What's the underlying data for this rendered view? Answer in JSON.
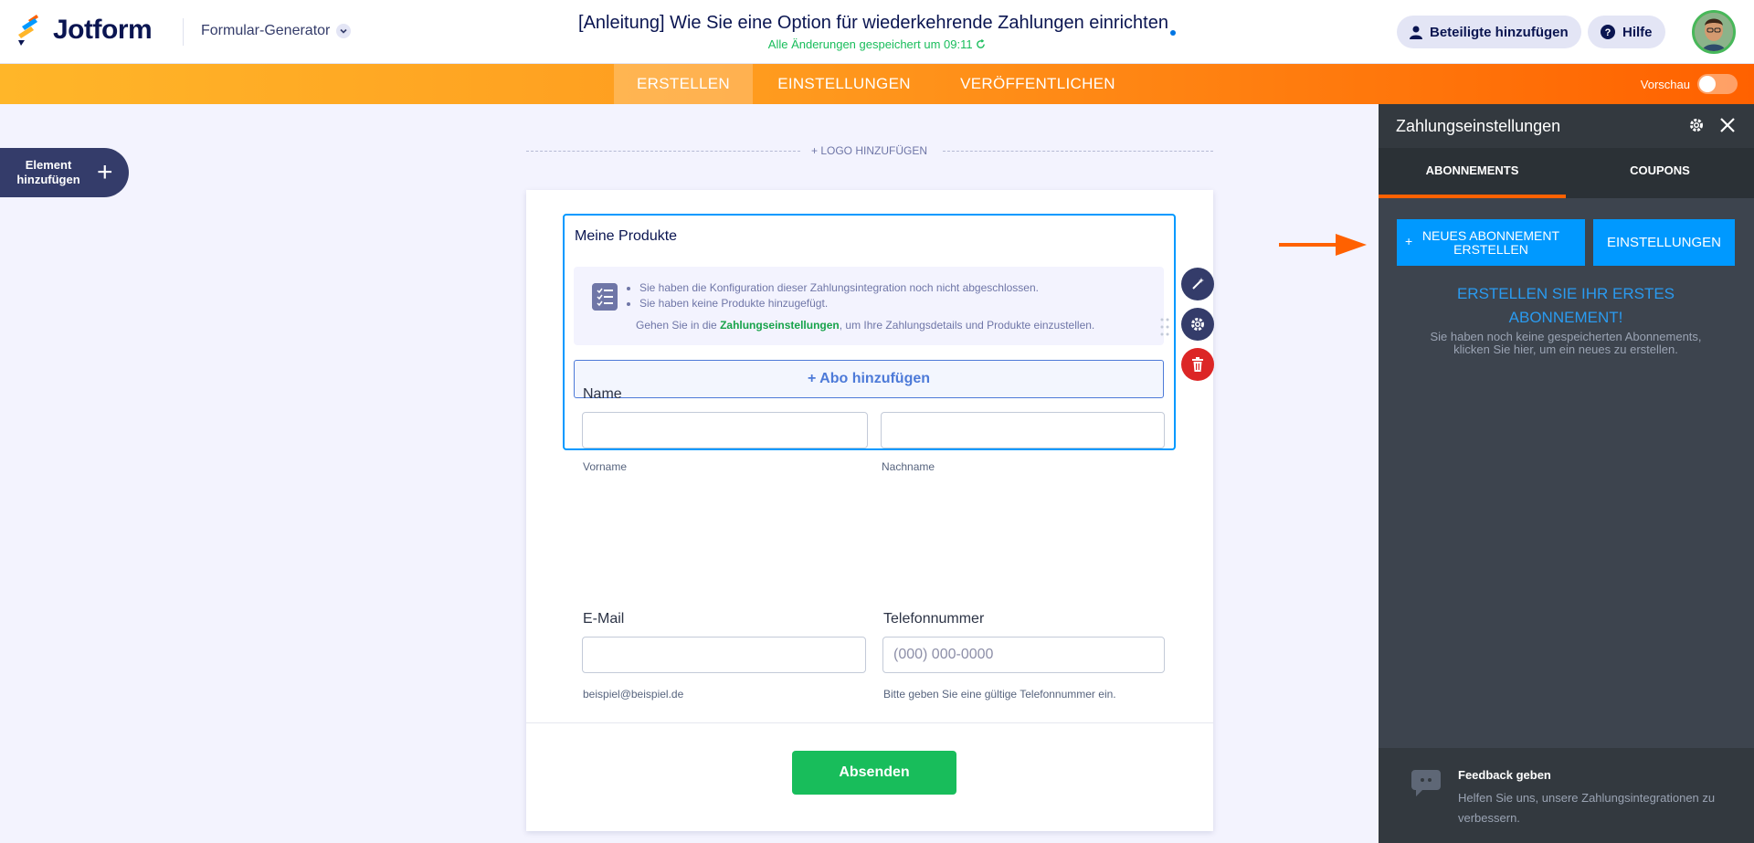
{
  "header": {
    "brand": "Jotform",
    "builder_label": "Formular-Generator",
    "form_title": "[Anleitung] Wie Sie eine Option für wiederkehrende Zahlungen einrichten",
    "save_status": "Alle Änderungen gespeichert um 09:11",
    "add_collaborators": "Beteiligte hinzufügen",
    "help": "Hilfe"
  },
  "nav": {
    "tabs": [
      {
        "label": "ERSTELLEN",
        "active": true
      },
      {
        "label": "EINSTELLUNGEN",
        "active": false
      },
      {
        "label": "VERÖFFENTLICHEN",
        "active": false
      }
    ],
    "preview_label": "Vorschau",
    "preview_on": false
  },
  "add_element": {
    "line1": "Element",
    "line2": "hinzufügen"
  },
  "logo_add": "+ LOGO HINZUFÜGEN",
  "form": {
    "products": {
      "title": "Meine Produkte",
      "warnings": [
        "Sie haben die Konfiguration dieser Zahlungsintegration noch nicht abgeschlossen.",
        "Sie haben keine Produkte hinzugefügt."
      ],
      "hint_before": "Gehen Sie in die ",
      "hint_link": "Zahlungseinstellungen",
      "hint_after": ", um Ihre Zahlungsdetails und Produkte einzustellen.",
      "add_subscription": "+ Abo hinzufügen"
    },
    "name": {
      "label": "Name",
      "first_sub": "Vorname",
      "last_sub": "Nachname",
      "first_value": "",
      "last_value": ""
    },
    "email": {
      "label": "E-Mail",
      "value": "",
      "sub": "beispiel@beispiel.de"
    },
    "phone": {
      "label": "Telefonnummer",
      "placeholder": "(000) 000-0000",
      "sub": "Bitte geben Sie eine gültige Telefonnummer ein."
    },
    "submit": "Absenden"
  },
  "panel": {
    "title": "Zahlungseinstellungen",
    "tabs": [
      {
        "label": "ABONNEMENTS",
        "active": true
      },
      {
        "label": "COUPONS",
        "active": false
      }
    ],
    "new_subscription": {
      "plus": "+",
      "line1": "NEUES ABONNEMENT",
      "line2": "ERSTELLEN"
    },
    "settings_button": "EINSTELLUNGEN",
    "empty_title_line1": "ERSTELLEN SIE IHR ERSTES",
    "empty_title_line2": "ABONNEMENT!",
    "empty_sub_line1": "Sie haben noch keine gespeicherten Abonnements,",
    "empty_sub_line2": "klicken Sie hier, um ein neues zu erstellen.",
    "feedback_title": "Feedback geben",
    "feedback_sub": "Helfen Sie uns, unsere Zahlungsintegrationen zu verbessern."
  },
  "colors": {
    "accent_orange": "#ff6100",
    "accent_blue": "#0099ff",
    "submit_green": "#18bd5b",
    "panel_bg": "#3d444e"
  },
  "icons": [
    "jotform-logo-icon",
    "chevron-down-icon",
    "sync-icon",
    "user-icon",
    "question-icon",
    "plus-icon",
    "checklist-icon",
    "magic-wand-icon",
    "gear-icon",
    "trash-icon",
    "drag-handle-icon",
    "arrow-right-icon",
    "close-icon",
    "chat-bubble-icon"
  ]
}
